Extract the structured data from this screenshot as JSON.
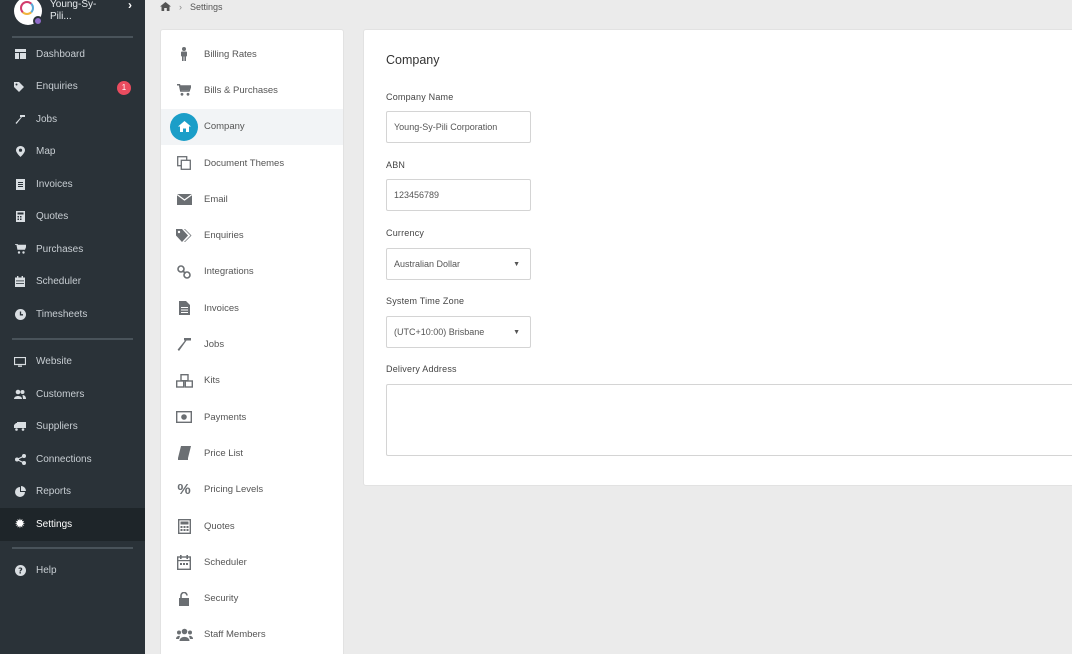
{
  "brand": {
    "name": "Young-Sy-Pili..."
  },
  "nav": {
    "group1": [
      {
        "label": "Dashboard",
        "icon": "dashboard-icon"
      },
      {
        "label": "Enquiries",
        "icon": "tags-icon",
        "badge": "1"
      },
      {
        "label": "Jobs",
        "icon": "hammer-icon"
      },
      {
        "label": "Map",
        "icon": "map-marker-icon"
      },
      {
        "label": "Invoices",
        "icon": "invoice-icon"
      },
      {
        "label": "Quotes",
        "icon": "calculator-icon"
      },
      {
        "label": "Purchases",
        "icon": "cart-icon"
      },
      {
        "label": "Scheduler",
        "icon": "calendar-icon"
      },
      {
        "label": "Timesheets",
        "icon": "clock-icon"
      }
    ],
    "group2": [
      {
        "label": "Website",
        "icon": "monitor-icon"
      },
      {
        "label": "Customers",
        "icon": "users-icon"
      },
      {
        "label": "Suppliers",
        "icon": "truck-icon"
      },
      {
        "label": "Connections",
        "icon": "share-icon"
      },
      {
        "label": "Reports",
        "icon": "pie-chart-icon"
      },
      {
        "label": "Settings",
        "icon": "gear-icon",
        "active": true
      }
    ],
    "group3": [
      {
        "label": "Help",
        "icon": "question-icon"
      }
    ]
  },
  "breadcrumb": {
    "current": "Settings"
  },
  "settings_menu": [
    {
      "label": "Billing Rates",
      "icon": "person-icon"
    },
    {
      "label": "Bills & Purchases",
      "icon": "cart-icon"
    },
    {
      "label": "Company",
      "icon": "home-icon",
      "active": true
    },
    {
      "label": "Document Themes",
      "icon": "copy-icon"
    },
    {
      "label": "Email",
      "icon": "envelope-icon"
    },
    {
      "label": "Enquiries",
      "icon": "tags-icon"
    },
    {
      "label": "Integrations",
      "icon": "link-icon"
    },
    {
      "label": "Invoices",
      "icon": "file-icon"
    },
    {
      "label": "Jobs",
      "icon": "hammer-icon"
    },
    {
      "label": "Kits",
      "icon": "cubes-icon"
    },
    {
      "label": "Payments",
      "icon": "money-icon"
    },
    {
      "label": "Price List",
      "icon": "book-icon"
    },
    {
      "label": "Pricing Levels",
      "icon": "percent-icon"
    },
    {
      "label": "Quotes",
      "icon": "calculator-icon"
    },
    {
      "label": "Scheduler",
      "icon": "calendar-icon"
    },
    {
      "label": "Security",
      "icon": "unlock-icon"
    },
    {
      "label": "Staff Members",
      "icon": "users-icon"
    }
  ],
  "company": {
    "title": "Company",
    "company_name_label": "Company Name",
    "company_name_value": "Young-Sy-Pili Corporation",
    "abn_label": "ABN",
    "abn_value": "123456789",
    "currency_label": "Currency",
    "currency_value": "Australian Dollar",
    "timezone_label": "System Time Zone",
    "timezone_value": "(UTC+10:00) Brisbane",
    "delivery_label": "Delivery Address",
    "delivery_value": ""
  },
  "colors": {
    "sidebar_bg": "#2a3238",
    "accent": "#1b9ec8",
    "badge": "#ea4c5f"
  }
}
